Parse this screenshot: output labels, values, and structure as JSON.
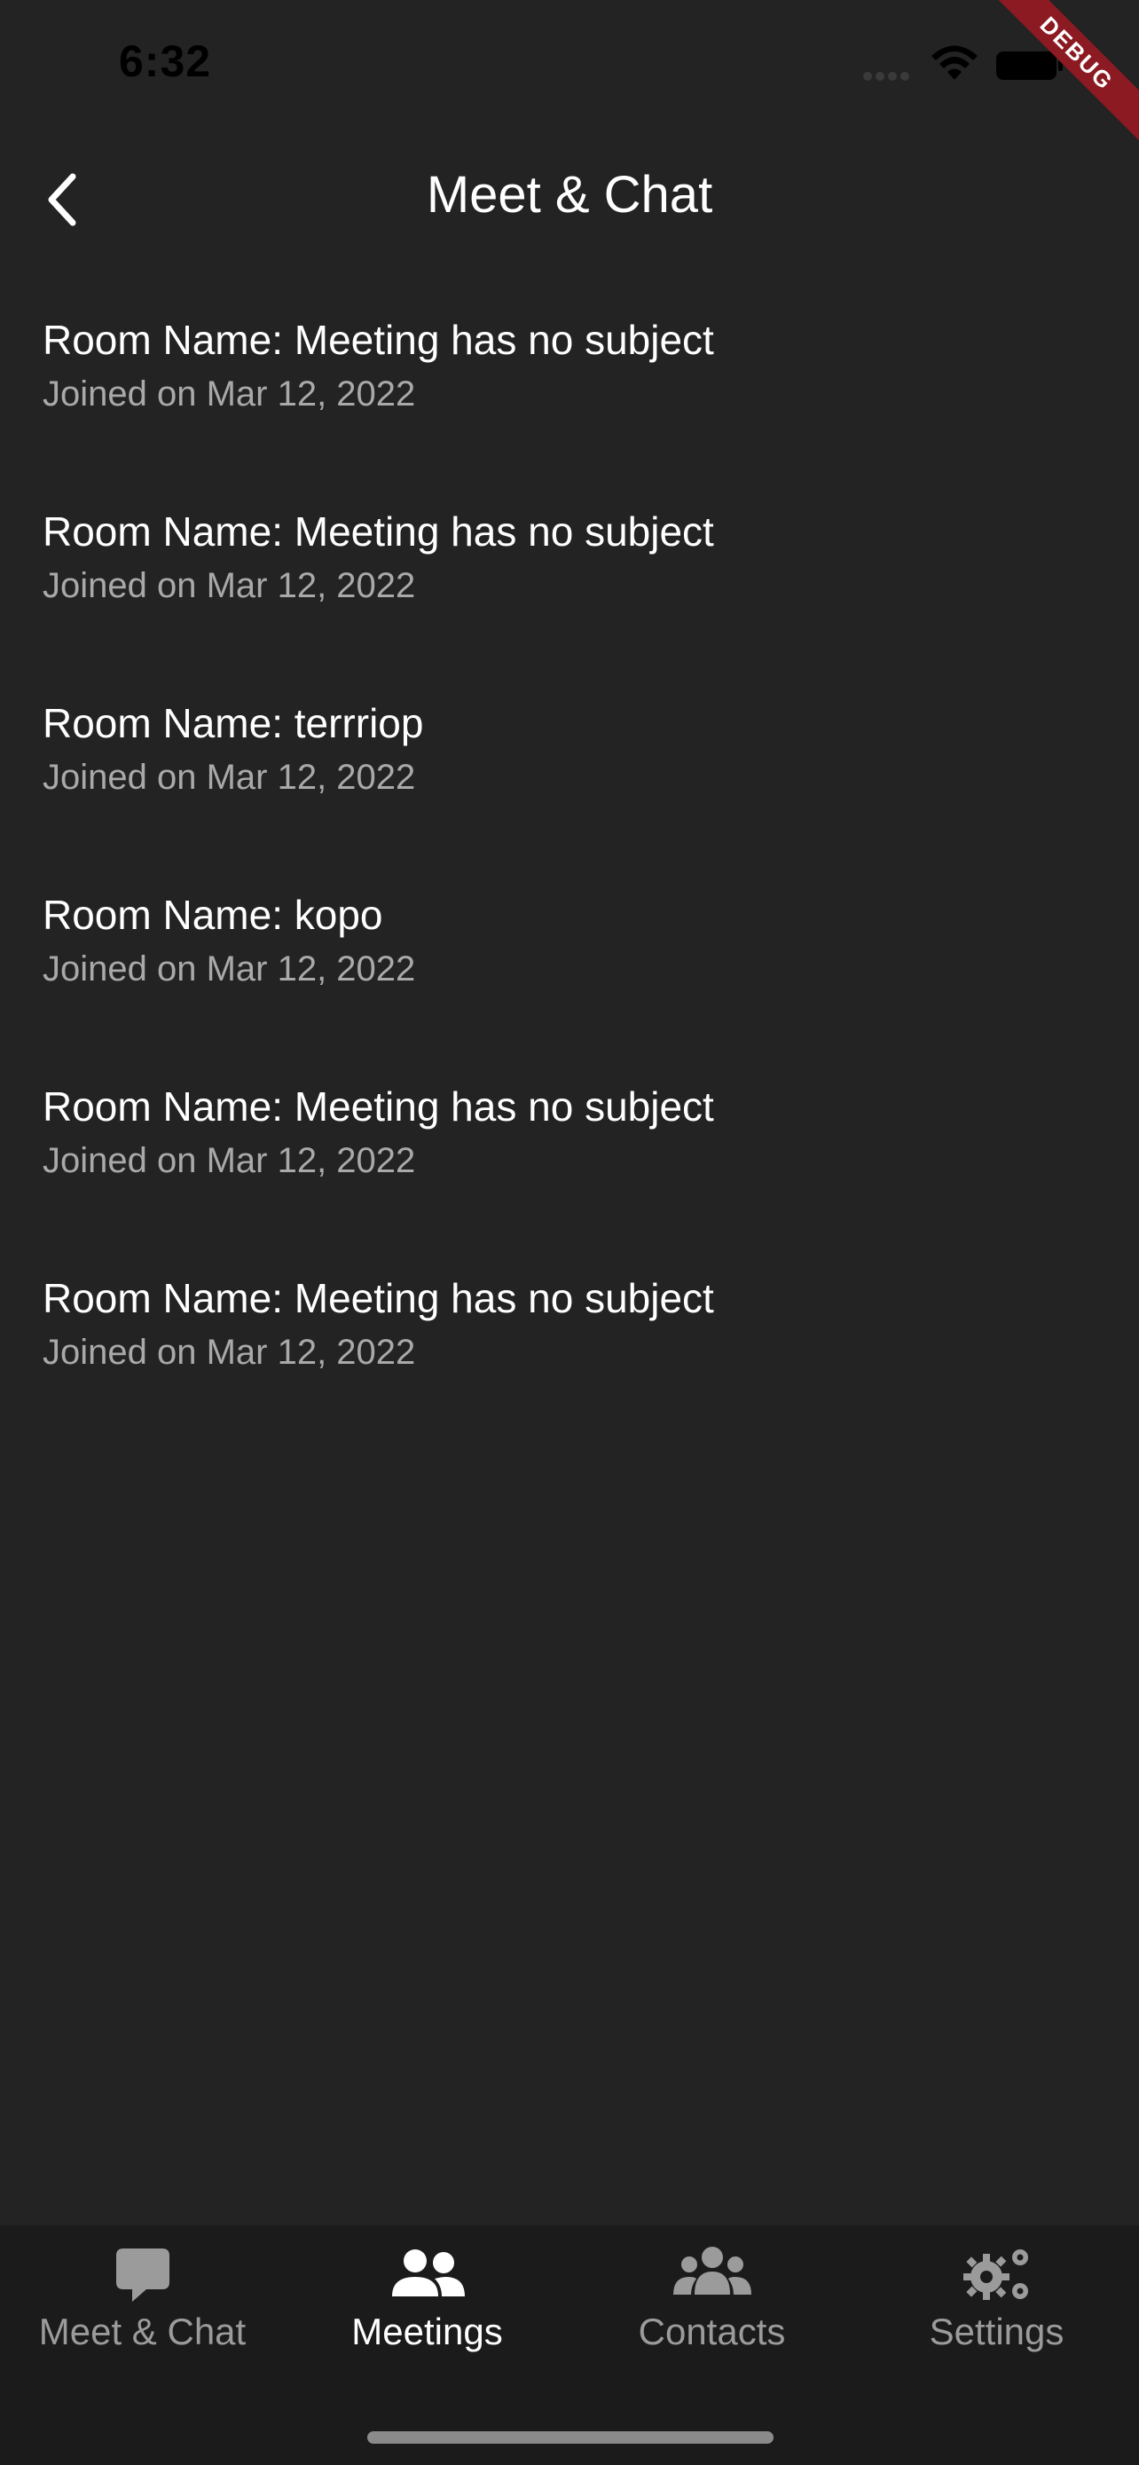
{
  "status_bar": {
    "time": "6:32",
    "signal_icon": "cellular-signal-icon",
    "wifi_icon": "wifi-icon",
    "battery_icon": "battery-icon"
  },
  "debug_banner": {
    "label": "DEBUG",
    "color": "#8c1a22"
  },
  "app_bar": {
    "back_icon": "chevron-left-icon",
    "title": "Meet & Chat"
  },
  "meetings": [
    {
      "room": "Room Name: Meeting has no subject",
      "joined": "Joined on Mar 12, 2022"
    },
    {
      "room": "Room Name: Meeting has no subject",
      "joined": "Joined on Mar 12, 2022"
    },
    {
      "room": "Room Name: terrriop",
      "joined": "Joined on Mar 12, 2022"
    },
    {
      "room": "Room Name: kopo",
      "joined": "Joined on Mar 12, 2022"
    },
    {
      "room": "Room Name: Meeting has no subject",
      "joined": "Joined on Mar 12, 2022"
    },
    {
      "room": "Room Name: Meeting has no subject",
      "joined": "Joined on Mar 12, 2022"
    }
  ],
  "bottom_nav": {
    "items": [
      {
        "label": "Meet & Chat",
        "icon": "chat-bubble-icon",
        "active": false
      },
      {
        "label": "Meetings",
        "icon": "people-icon",
        "active": true
      },
      {
        "label": "Contacts",
        "icon": "group-icon",
        "active": false
      },
      {
        "label": "Settings",
        "icon": "gears-icon",
        "active": false
      }
    ]
  },
  "colors": {
    "background": "#232323",
    "nav_background": "#1b1b1b",
    "active_label": "#ffffff",
    "inactive_label": "#9b9b9b",
    "subtitle": "#a9a9a9"
  }
}
